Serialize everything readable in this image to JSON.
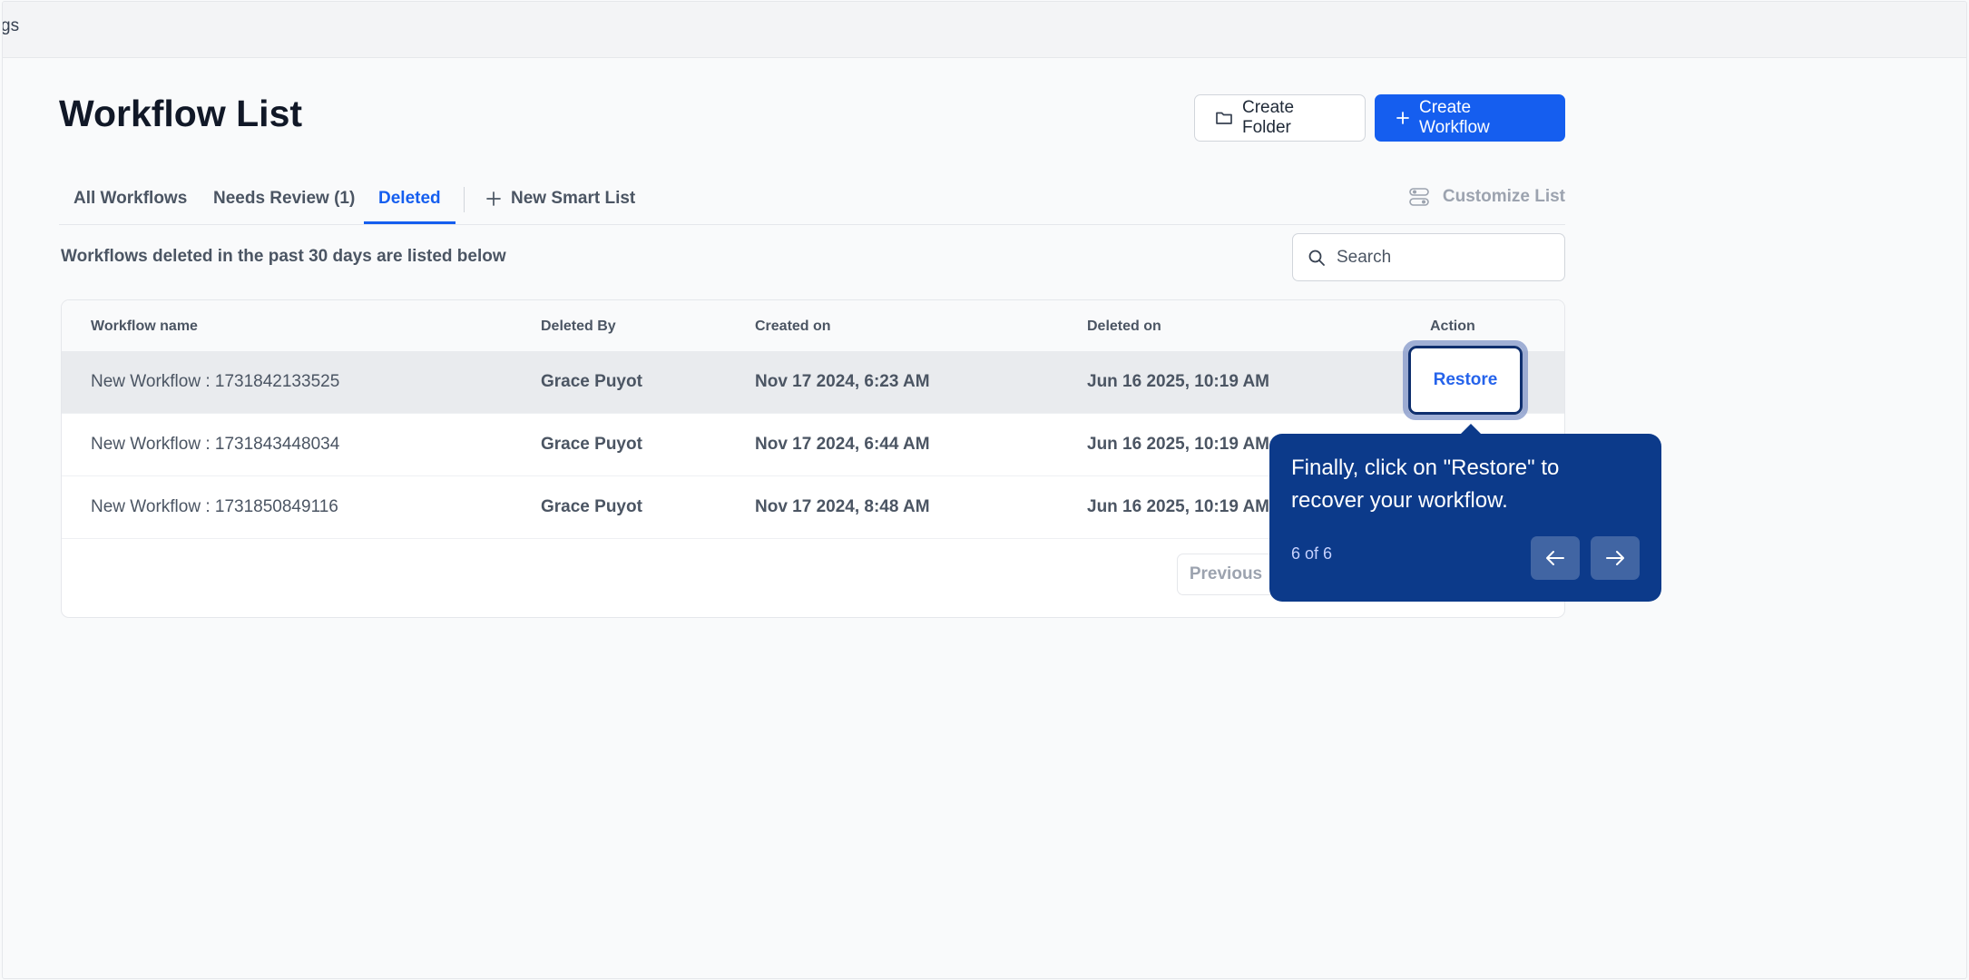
{
  "topbar": {
    "partial_text": "gs"
  },
  "page": {
    "title": "Workflow List"
  },
  "header_actions": {
    "create_folder": "Create Folder",
    "create_workflow": "Create Workflow",
    "folder_icon": "folder-icon",
    "plus_icon": "plus-icon"
  },
  "tabs": {
    "all": "All Workflows",
    "needs_review": "Needs Review (1)",
    "deleted": "Deleted",
    "new_smart_list": "New Smart List",
    "customize": "Customize List"
  },
  "subtitle": "Workflows deleted in the past 30 days are listed below",
  "search": {
    "placeholder": "Search",
    "value": ""
  },
  "table": {
    "headers": [
      "Workflow name",
      "Deleted By",
      "Created on",
      "Deleted on",
      "Action"
    ],
    "rows": [
      {
        "name": "New Workflow : 1731842133525",
        "deleted_by": "Grace Puyot",
        "created_on": "Nov 17 2024, 6:23 AM",
        "deleted_on": "Jun 16 2025, 10:19 AM",
        "action": "Restore"
      },
      {
        "name": "New Workflow : 1731843448034",
        "deleted_by": "Grace Puyot",
        "created_on": "Nov 17 2024, 6:44 AM",
        "deleted_on": "Jun 16 2025, 10:19 AM"
      },
      {
        "name": "New Workflow : 1731850849116",
        "deleted_by": "Grace Puyot",
        "created_on": "Nov 17 2024, 8:48 AM",
        "deleted_on": "Jun 16 2025, 10:19 AM"
      }
    ],
    "pagination": {
      "previous": "Previous"
    }
  },
  "tooltip": {
    "text": "Finally, click on \"Restore\" to recover your workflow.",
    "step": "6 of 6"
  },
  "colors": {
    "primary": "#155eef",
    "tooltip_bg": "#0c3a8a",
    "muted": "#9ca3af"
  }
}
